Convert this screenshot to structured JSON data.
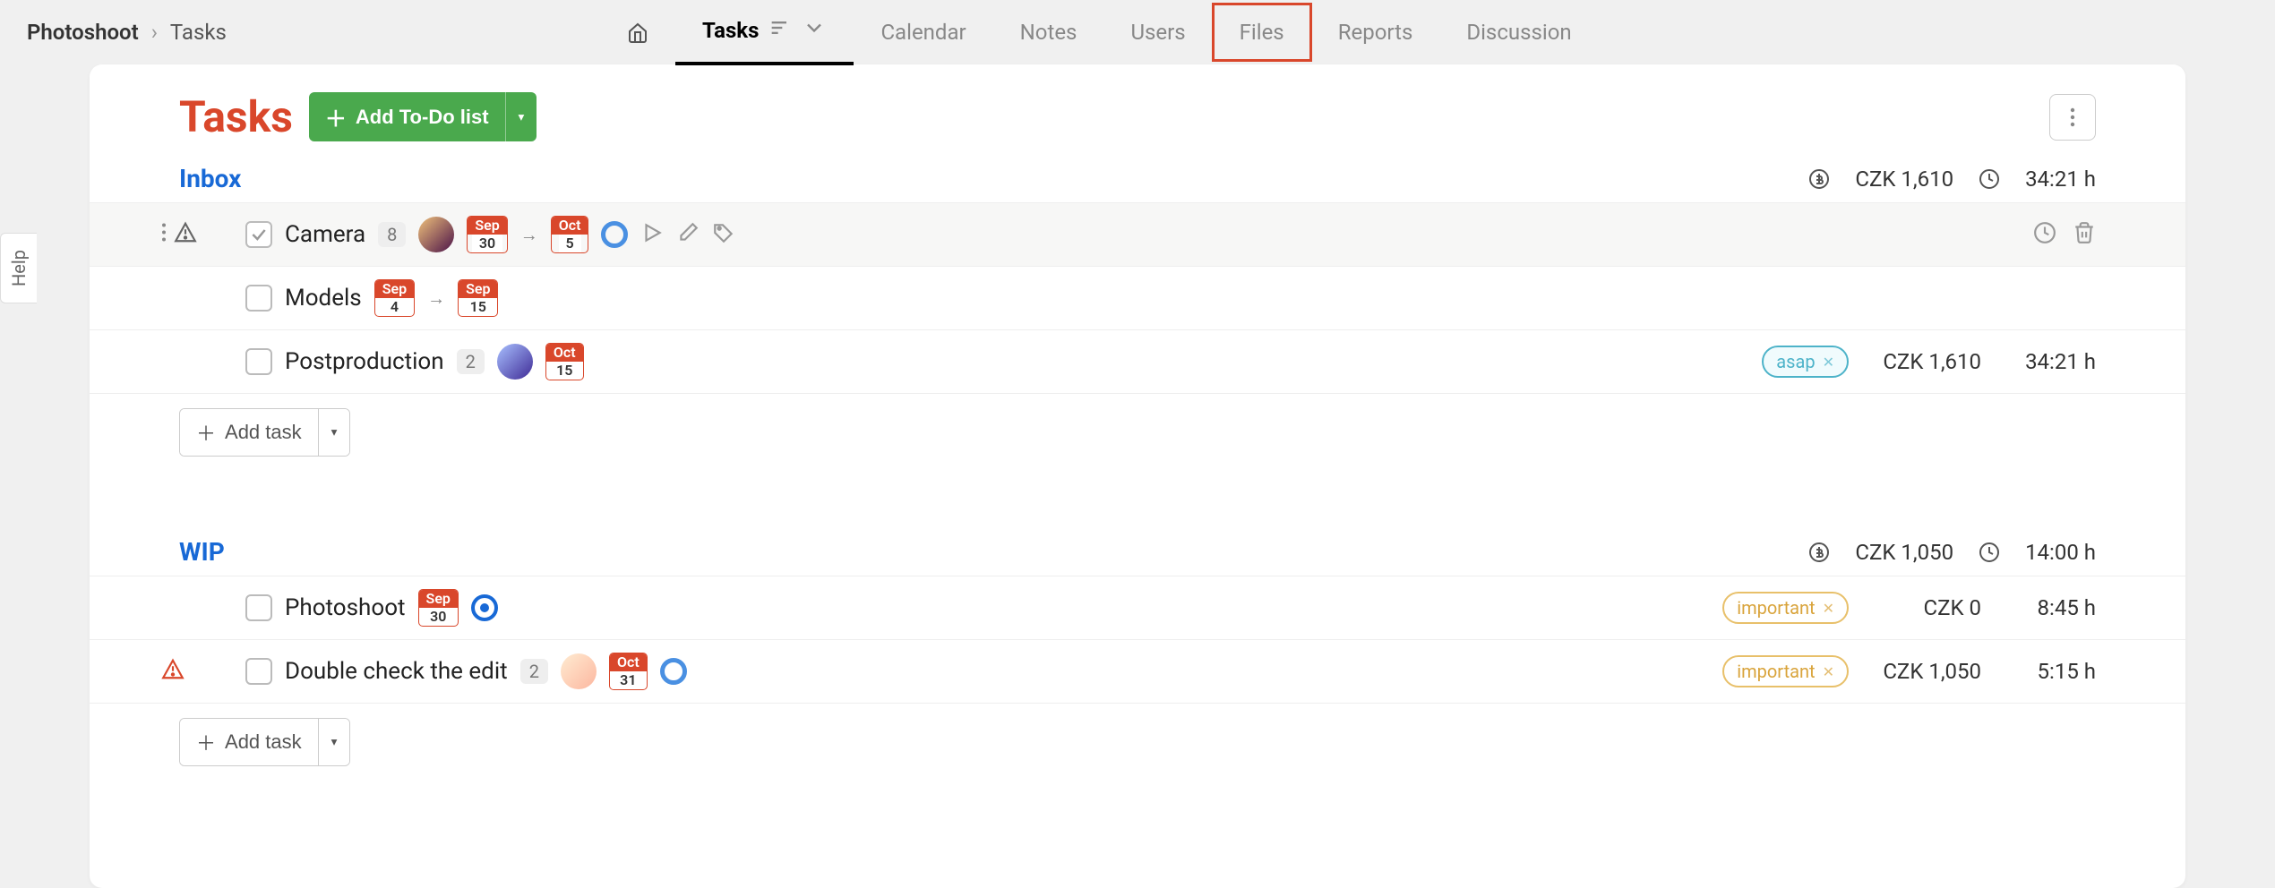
{
  "breadcrumb": {
    "project": "Photoshoot",
    "current": "Tasks"
  },
  "nav": {
    "tasks": "Tasks",
    "calendar": "Calendar",
    "notes": "Notes",
    "users": "Users",
    "files": "Files",
    "reports": "Reports",
    "discussion": "Discussion"
  },
  "page": {
    "title": "Tasks",
    "add_todo": "Add To-Do list"
  },
  "help_label": "Help",
  "sections": {
    "inbox": {
      "title": "Inbox",
      "cost_label": "CZK 1,610",
      "time_label": "34:21 h",
      "tasks": [
        {
          "name": "Camera",
          "count": "8",
          "date_from_m": "Sep",
          "date_from_d": "30",
          "date_to_m": "Oct",
          "date_to_d": "5"
        },
        {
          "name": "Models",
          "date_from_m": "Sep",
          "date_from_d": "4",
          "date_to_m": "Sep",
          "date_to_d": "15"
        },
        {
          "name": "Postproduction",
          "count": "2",
          "date_to_m": "Oct",
          "date_to_d": "15",
          "tag": "asap",
          "cost": "CZK 1,610",
          "time": "34:21 h"
        }
      ],
      "add_label": "Add task"
    },
    "wip": {
      "title": "WIP",
      "cost_label": "CZK 1,050",
      "time_label": "14:00 h",
      "tasks": [
        {
          "name": "Photoshoot",
          "date_to_m": "Sep",
          "date_to_d": "30",
          "tag": "important",
          "cost": "CZK 0",
          "time": "8:45 h"
        },
        {
          "name": "Double check the edit",
          "count": "2",
          "date_to_m": "Oct",
          "date_to_d": "31",
          "tag": "important",
          "cost": "CZK 1,050",
          "time": "5:15 h"
        }
      ],
      "add_label": "Add task"
    }
  }
}
